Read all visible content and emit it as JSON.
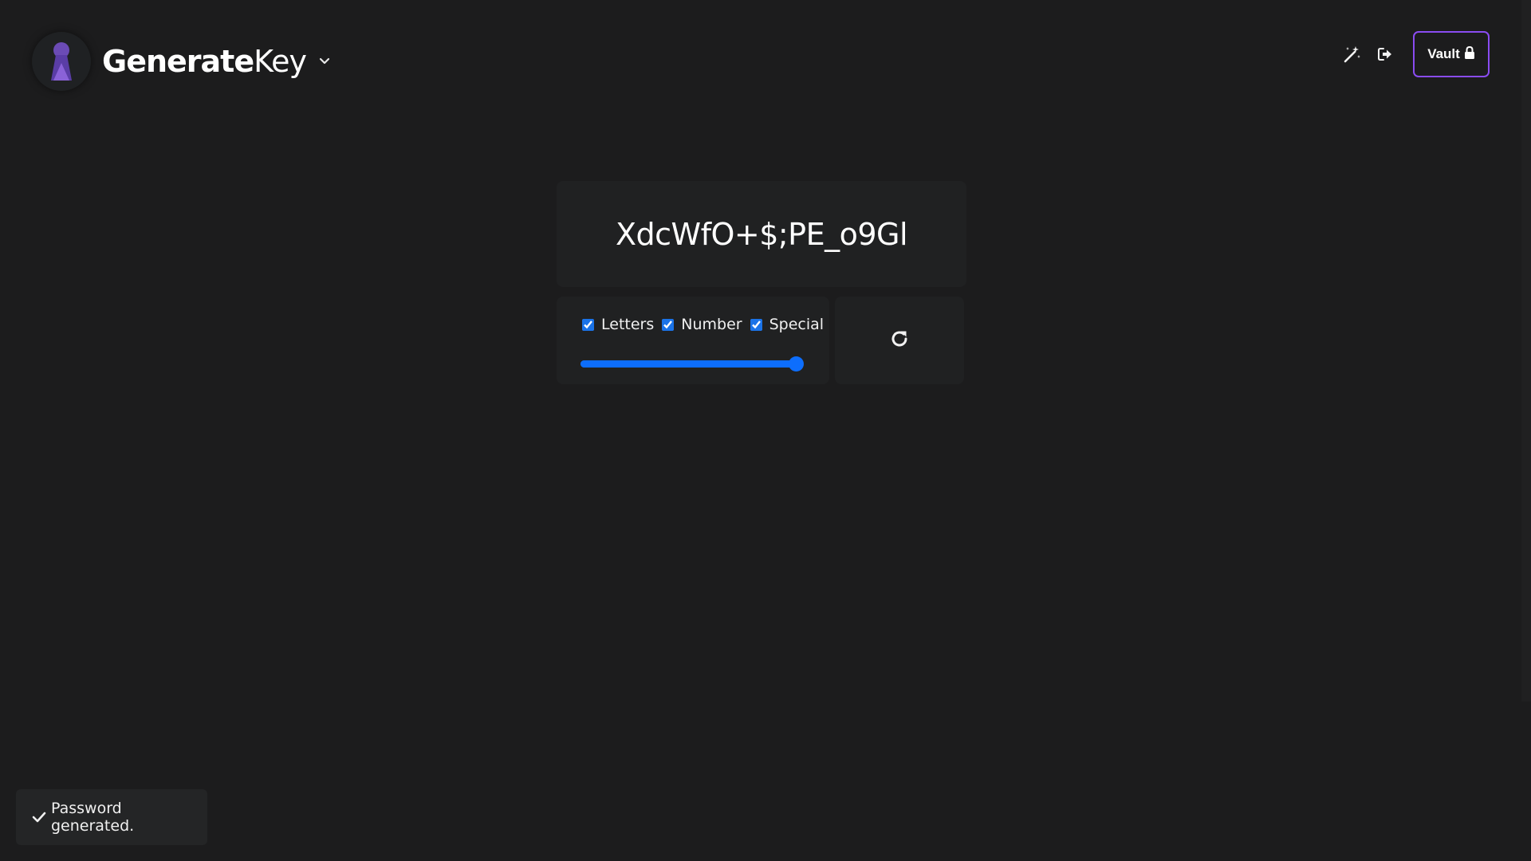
{
  "header": {
    "brand_bold": "Generate",
    "brand_light": "Key",
    "vault_label": "Vault",
    "logo_icon": "keyhole-icon",
    "dropdown_icon": "chevron-down-icon",
    "tools": [
      "magic-wand-icon",
      "sign-out-icon"
    ],
    "accent_color": "#8a4cf2"
  },
  "generator": {
    "password": "XdcWfO+$;PE_o9Gl",
    "options": [
      {
        "label": "Letters",
        "checked": true
      },
      {
        "label": "Number",
        "checked": true
      },
      {
        "label": "Special",
        "checked": true
      }
    ],
    "length_fraction": 0.97,
    "slider_color": "#0d6efd",
    "refresh_icon": "rotate-right-icon"
  },
  "toast": {
    "message": "Password generated.",
    "icon": "check-icon"
  }
}
